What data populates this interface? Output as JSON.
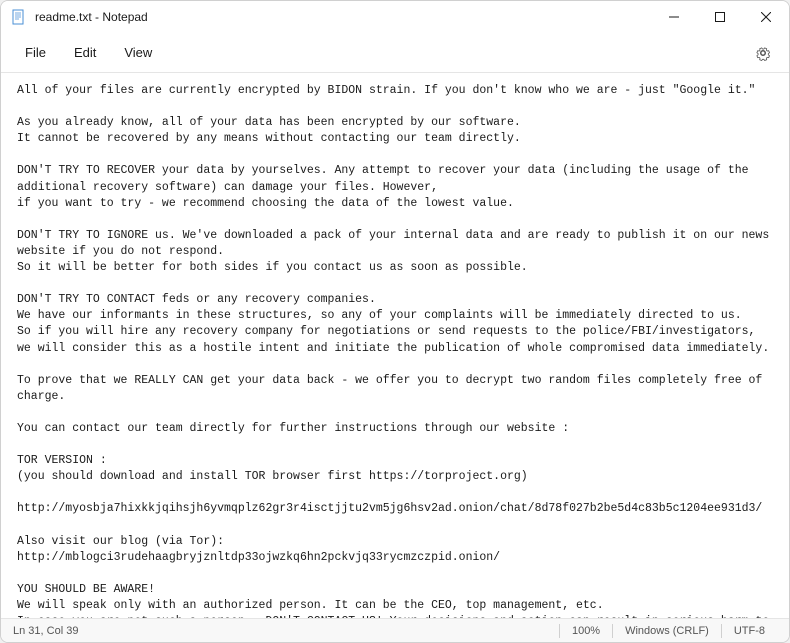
{
  "window": {
    "title": "readme.txt - Notepad"
  },
  "menu": {
    "file": "File",
    "edit": "Edit",
    "view": "View"
  },
  "content": {
    "text": "All of your files are currently encrypted by BIDON strain. If you don't know who we are - just \"Google it.\"\n\nAs you already know, all of your data has been encrypted by our software.\nIt cannot be recovered by any means without contacting our team directly.\n\nDON'T TRY TO RECOVER your data by yourselves. Any attempt to recover your data (including the usage of the additional recovery software) can damage your files. However,\nif you want to try - we recommend choosing the data of the lowest value.\n\nDON'T TRY TO IGNORE us. We've downloaded a pack of your internal data and are ready to publish it on our news website if you do not respond.\nSo it will be better for both sides if you contact us as soon as possible.\n\nDON'T TRY TO CONTACT feds or any recovery companies.\nWe have our informants in these structures, so any of your complaints will be immediately directed to us.\nSo if you will hire any recovery company for negotiations or send requests to the police/FBI/investigators, we will consider this as a hostile intent and initiate the publication of whole compromised data immediately.\n\nTo prove that we REALLY CAN get your data back - we offer you to decrypt two random files completely free of charge.\n\nYou can contact our team directly for further instructions through our website :\n\nTOR VERSION :\n(you should download and install TOR browser first https://torproject.org)\n\nhttp://myosbja7hixkkjqihsjh6yvmqplz62gr3r4isctjjtu2vm5jg6hsv2ad.onion/chat/8d78f027b2be5d4c83b5c1204ee931d3/\n\nAlso visit our blog (via Tor):\nhttp://mblogci3rudehaagbryjznltdp33ojwzkq6hn2pckvjq33rycmzczpid.onion/\n\nYOU SHOULD BE AWARE!\nWe will speak only with an authorized person. It can be the CEO, top management, etc.\nIn case you are not such a person - DON'T CONTACT US! Your decisions and action can result in serious harm to your company!\nInform your supervisors and stay calm!"
  },
  "statusbar": {
    "position": "Ln 31, Col 39",
    "zoom": "100%",
    "line_ending": "Windows (CRLF)",
    "encoding": "UTF-8"
  }
}
